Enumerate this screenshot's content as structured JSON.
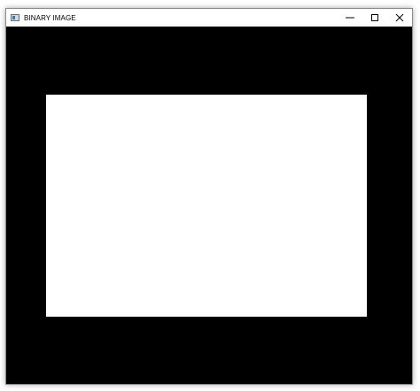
{
  "window": {
    "title": "BINARY IMAGE",
    "icon": "app-window-icon"
  },
  "controls": {
    "minimize_icon": "minimize-icon",
    "maximize_icon": "maximize-icon",
    "close_icon": "close-icon"
  },
  "image": {
    "background_color": "#000000",
    "foreground_color": "#ffffff"
  }
}
